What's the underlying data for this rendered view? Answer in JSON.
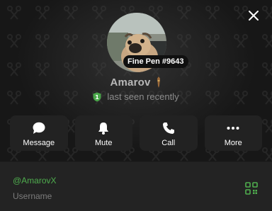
{
  "profile": {
    "name": "Amarov",
    "gift_tag": "Fine Pen #9643",
    "status": "last seen recently"
  },
  "actions": [
    {
      "label": "Message",
      "icon": "message-icon"
    },
    {
      "label": "Mute",
      "icon": "bell-icon"
    },
    {
      "label": "Call",
      "icon": "phone-icon"
    },
    {
      "label": "More",
      "icon": "more-icon"
    }
  ],
  "info": {
    "username": "@AmarovX",
    "username_label": "Username"
  },
  "colors": {
    "accent_green": "#4fae4e",
    "shield_green": "#49a649"
  }
}
